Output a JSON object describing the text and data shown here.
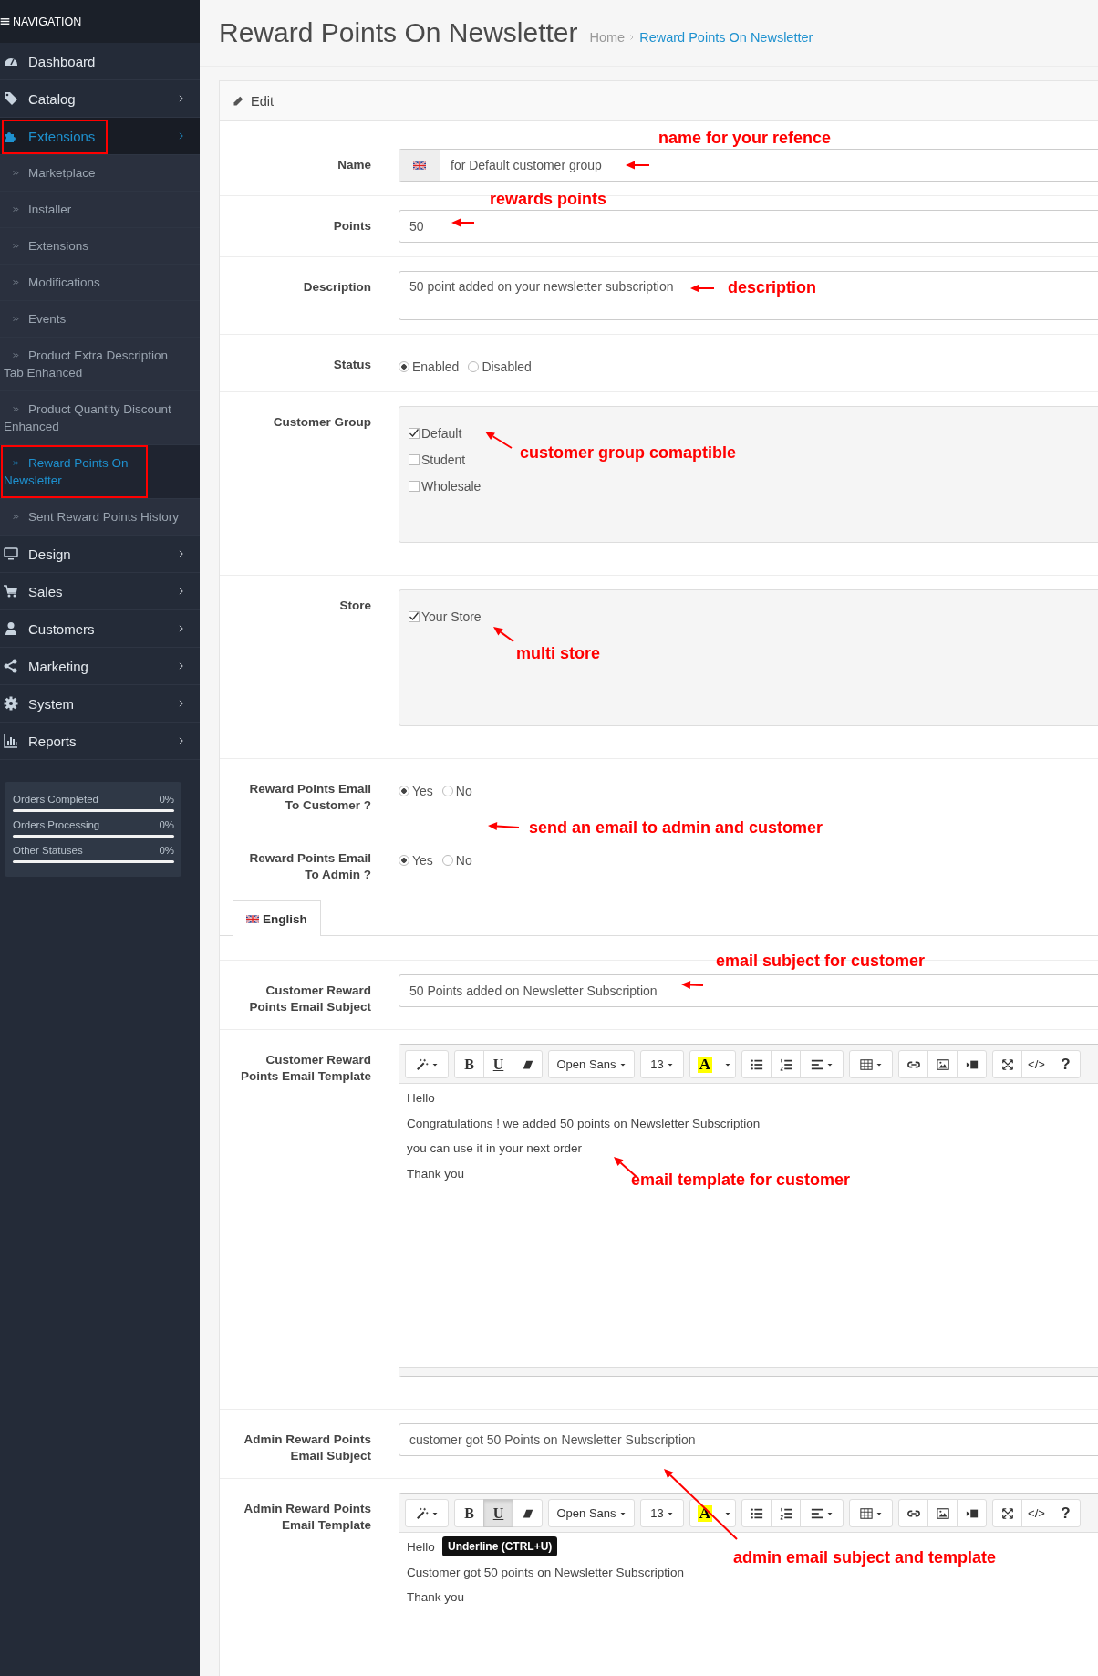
{
  "sidebar": {
    "header": "NAVIGATION",
    "menu": [
      {
        "label": "Dashboard",
        "selected": false,
        "boxed": false,
        "has_submenu": false
      },
      {
        "label": "Catalog",
        "selected": false,
        "boxed": false,
        "has_submenu": true
      },
      {
        "label": "Extensions",
        "selected": true,
        "boxed": true,
        "has_submenu": true,
        "children": [
          {
            "label": "Marketplace",
            "selected": false,
            "boxed": false
          },
          {
            "label": "Installer",
            "selected": false,
            "boxed": false
          },
          {
            "label": "Extensions",
            "selected": false,
            "boxed": false
          },
          {
            "label": "Modifications",
            "selected": false,
            "boxed": false
          },
          {
            "label": "Events",
            "selected": false,
            "boxed": false
          },
          {
            "label": "Product Extra Description Tab Enhanced",
            "selected": false,
            "boxed": false
          },
          {
            "label": "Product Quantity Discount Enhanced",
            "selected": false,
            "boxed": false
          },
          {
            "label": "Reward Points On Newsletter",
            "selected": true,
            "boxed": true
          },
          {
            "label": "Sent Reward Points History",
            "selected": false,
            "boxed": false
          }
        ]
      },
      {
        "label": "Design",
        "selected": false,
        "boxed": false,
        "has_submenu": true
      },
      {
        "label": "Sales",
        "selected": false,
        "boxed": false,
        "has_submenu": true
      },
      {
        "label": "Customers",
        "selected": false,
        "boxed": false,
        "has_submenu": true
      },
      {
        "label": "Marketing",
        "selected": false,
        "boxed": false,
        "has_submenu": true
      },
      {
        "label": "System",
        "selected": false,
        "boxed": false,
        "has_submenu": true
      },
      {
        "label": "Reports",
        "selected": false,
        "boxed": false,
        "has_submenu": true
      }
    ],
    "stats": [
      {
        "label": "Orders Completed",
        "value": "0%",
        "level": 0
      },
      {
        "label": "Orders Processing",
        "value": "0%",
        "level": 0
      },
      {
        "label": "Other Statuses",
        "value": "0%",
        "level": 0
      }
    ]
  },
  "page": {
    "title": "Reward Points On Newsletter",
    "breadcrumb": [
      {
        "label": "Home",
        "current": false
      },
      {
        "label": "Reward Points On Newsletter",
        "current": true
      }
    ]
  },
  "panel": {
    "heading": "Edit",
    "fields": [
      {
        "kind": "input",
        "label": "Name",
        "value": "for Default customer group",
        "flag": true
      },
      {
        "kind": "input",
        "label": "Points",
        "value": "50",
        "flag": false
      },
      {
        "kind": "textarea",
        "label": "Description",
        "value": "50 point added on your newsletter subscription"
      },
      {
        "kind": "radio",
        "label": "Status",
        "options": [
          {
            "label": "Enabled",
            "selected": true
          },
          {
            "label": "Disabled",
            "selected": false
          }
        ]
      },
      {
        "kind": "checklist",
        "label": "Customer Group",
        "options": [
          {
            "label": "Default",
            "checked": true
          },
          {
            "label": "Student",
            "checked": false
          },
          {
            "label": "Wholesale",
            "checked": false
          }
        ]
      },
      {
        "kind": "checklist",
        "label": "Store",
        "options": [
          {
            "label": "Your Store",
            "checked": true
          }
        ]
      },
      {
        "kind": "radio",
        "label": "Reward Points Email To Customer ?",
        "options": [
          {
            "label": "Yes",
            "selected": true
          },
          {
            "label": "No",
            "selected": false
          }
        ]
      },
      {
        "kind": "radio",
        "label": "Reward Points Email To Admin ?",
        "options": [
          {
            "label": "Yes",
            "selected": true
          },
          {
            "label": "No",
            "selected": false
          }
        ]
      },
      {
        "kind": "tabs",
        "tabs": [
          {
            "label": "English",
            "selected": true
          }
        ]
      },
      {
        "kind": "input",
        "label": "Customer Reward Points Email Subject",
        "value": "50 Points added on Newsletter Subscription",
        "flag": false
      },
      {
        "kind": "editor",
        "label": "Customer Reward Points Email Template",
        "toolbar": {
          "bold": "B",
          "underline": "U",
          "font": "Open Sans",
          "size": "13",
          "highlight": "A",
          "code": "</>",
          "help": "?"
        },
        "underline_pressed": false,
        "resize_handle": true,
        "lines": [
          "Hello",
          "Congratulations ! we added 50 points on Newsletter Subscription",
          "you can use it in your next order",
          "Thank you"
        ]
      },
      {
        "kind": "input",
        "label": "Admin Reward Points Email Subject",
        "value": "customer got 50 Points on Newsletter Subscription",
        "flag": false
      },
      {
        "kind": "editor",
        "label": "Admin Reward Points Email Template",
        "toolbar": {
          "bold": "B",
          "underline": "U",
          "font": "Open Sans",
          "size": "13",
          "highlight": "A",
          "code": "</>",
          "help": "?"
        },
        "underline_pressed": true,
        "tooltip": "Underline (CTRL+U)",
        "lines": [
          "Hello",
          "Customer got 50 points on Newsletter Subscription",
          "Thank you"
        ]
      }
    ]
  },
  "annotations": [
    {
      "text": "name for your refence"
    },
    {
      "text": "rewards points"
    },
    {
      "text": "description"
    },
    {
      "text": "customer group comaptible"
    },
    {
      "text": "multi store"
    },
    {
      "text": "send an email to admin and customer"
    },
    {
      "text": "email subject for customer"
    },
    {
      "text": "email template for customer"
    },
    {
      "text": "admin email subject and template"
    }
  ]
}
